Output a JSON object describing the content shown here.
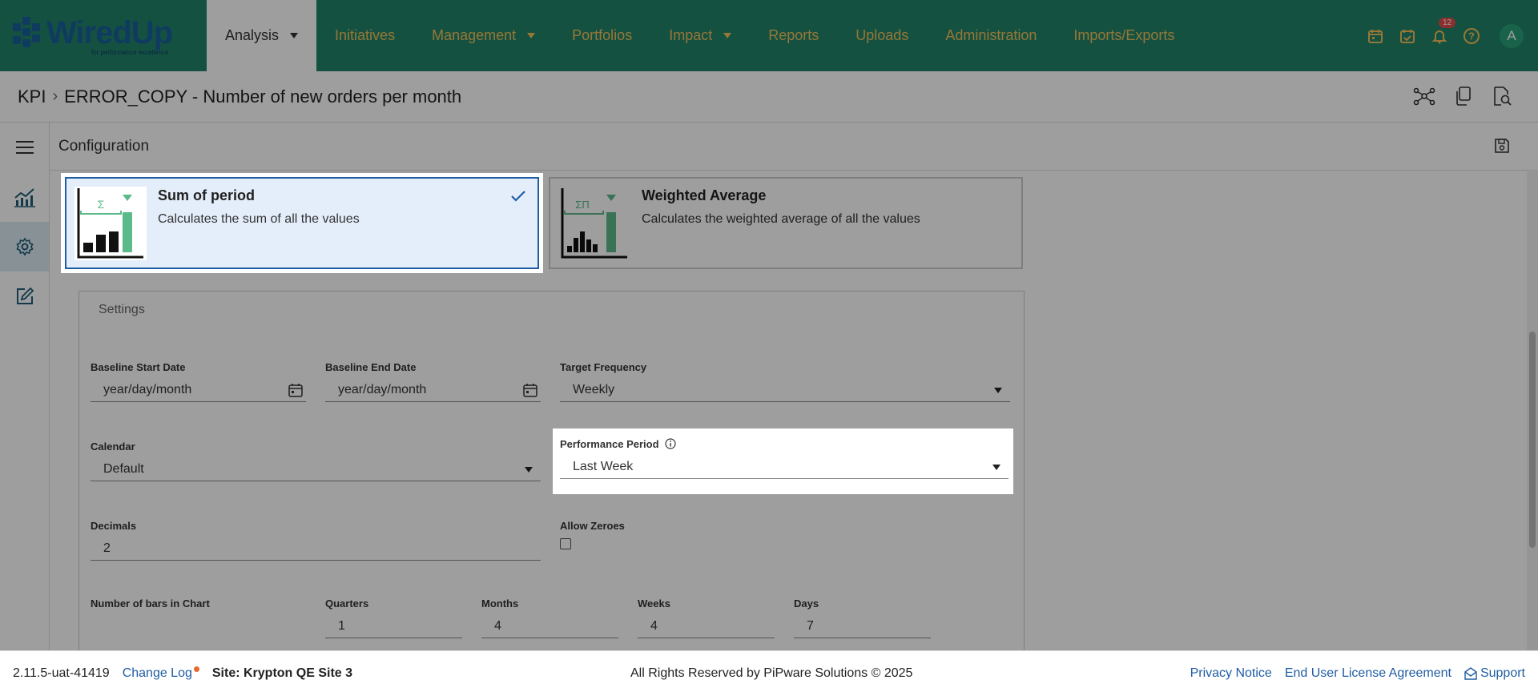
{
  "app": {
    "logo_text": "WiredUp",
    "logo_tagline": "for performance excellence"
  },
  "nav": {
    "items": [
      {
        "label": "Analysis",
        "has_caret": true
      },
      {
        "label": "Initiatives",
        "has_caret": false
      },
      {
        "label": "Management",
        "has_caret": true
      },
      {
        "label": "Portfolios",
        "has_caret": false
      },
      {
        "label": "Impact",
        "has_caret": true
      },
      {
        "label": "Reports",
        "has_caret": false
      },
      {
        "label": "Uploads",
        "has_caret": false
      },
      {
        "label": "Administration",
        "has_caret": false
      },
      {
        "label": "Imports/Exports",
        "has_caret": false
      }
    ],
    "notification_count": "12",
    "avatar_initial": "A"
  },
  "breadcrumb": {
    "root": "KPI",
    "current": "ERROR_COPY - Number of new orders per month"
  },
  "config": {
    "title": "Configuration"
  },
  "cards": {
    "sum": {
      "title": "Sum of period",
      "desc": "Calculates the sum of all the values",
      "symbol": "Σ"
    },
    "weighted": {
      "title": "Weighted Average",
      "desc": "Calculates the weighted average of all the values",
      "symbol": "ΣΠ"
    }
  },
  "settings": {
    "title": "Settings",
    "baseline_start": {
      "label": "Baseline Start Date",
      "value": "year/day/month"
    },
    "baseline_end": {
      "label": "Baseline End Date",
      "value": "year/day/month"
    },
    "target_frequency": {
      "label": "Target Frequency",
      "value": "Weekly"
    },
    "calendar": {
      "label": "Calendar",
      "value": "Default"
    },
    "performance_period": {
      "label": "Performance Period",
      "value": "Last Week"
    },
    "decimals": {
      "label": "Decimals",
      "value": "2"
    },
    "allow_zeroes": {
      "label": "Allow Zeroes"
    },
    "bars": {
      "label": "Number of bars in Chart"
    },
    "quarters": {
      "label": "Quarters",
      "value": "1"
    },
    "months": {
      "label": "Months",
      "value": "4"
    },
    "weeks": {
      "label": "Weeks",
      "value": "4"
    },
    "days": {
      "label": "Days",
      "value": "7"
    }
  },
  "footer": {
    "version": "2.11.5-uat-41419",
    "changelog": "Change Log",
    "site": "Site: Krypton QE Site 3",
    "copyright": "All Rights Reserved by PiPware Solutions © 2025",
    "privacy": "Privacy Notice",
    "eula": "End User License Agreement",
    "support": "Support"
  }
}
